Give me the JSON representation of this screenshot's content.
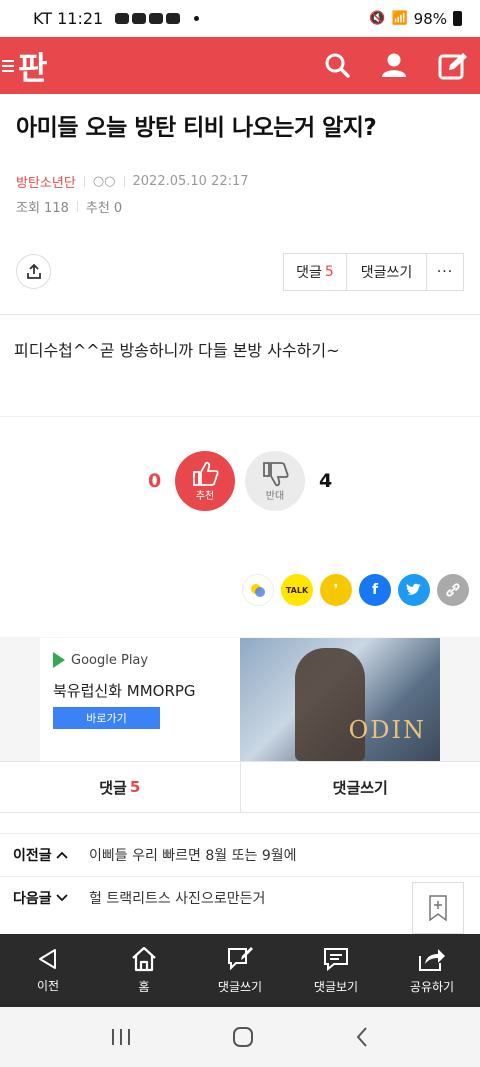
{
  "status_bar": {
    "carrier_time": "KT 11:21",
    "battery": "98%"
  },
  "header": {
    "logo": "판"
  },
  "post": {
    "title": "아미들 오늘 방탄 티비 나오는거 알지?",
    "author": "방탄소년단",
    "nickname": "○○",
    "datetime": "2022.05.10 22:17",
    "views": "조회 118",
    "recommend": "추천 0",
    "body": "피디수첩^^곧 방송하니까 다들 본방 사수하기~"
  },
  "actions": {
    "comment_label": "댓글",
    "comment_count": "5",
    "write_comment": "댓글쓰기",
    "more": "···"
  },
  "vote": {
    "up_count": "0",
    "up_label": "추천",
    "down_count": "4",
    "down_label": "반대"
  },
  "share": {
    "kakao_talk": "TALK"
  },
  "ad": {
    "store": "Google Play",
    "headline": "북유럽신화 MMORPG",
    "cta": "바로가기",
    "game_logo": "ODIN"
  },
  "comment_bar": {
    "comment_label": "댓글",
    "comment_count": "5",
    "write_comment": "댓글쓰기"
  },
  "nav": {
    "prev_label": "이전글",
    "prev_title": "이삐들 우리 빠르면 8월 또는 9월에",
    "next_label": "다음글",
    "next_title": "헐 트랙리트스 사진으로만든거"
  },
  "bottom_bar": [
    {
      "label": "이전"
    },
    {
      "label": "홈"
    },
    {
      "label": "댓글쓰기"
    },
    {
      "label": "댓글보기"
    },
    {
      "label": "공유하기"
    }
  ],
  "colors": {
    "brand": "#e8484b",
    "dark_bar": "#2b2b2b"
  }
}
